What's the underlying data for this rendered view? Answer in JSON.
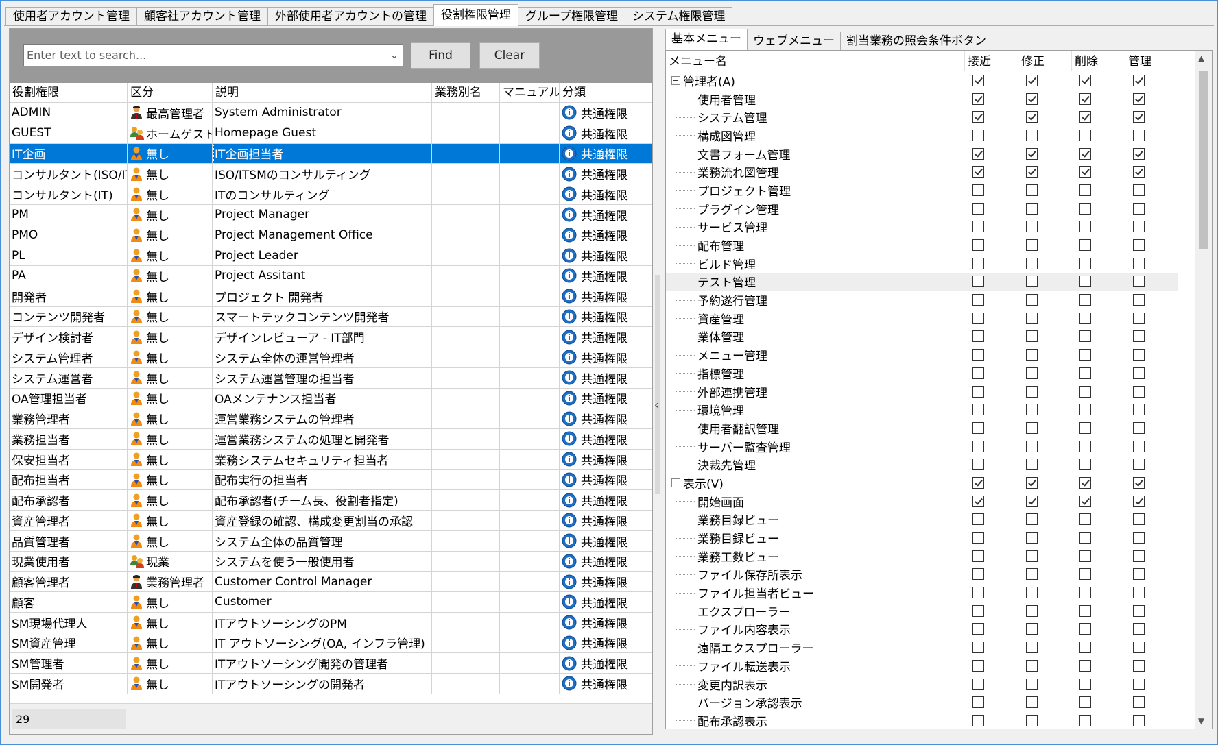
{
  "top_tabs": [
    "使用者アカウント管理",
    "顧客社アカウント管理",
    "外部使用者アカウントの管理",
    "役割権限管理",
    "グループ権限管理",
    "システム権限管理"
  ],
  "search": {
    "placeholder": "Enter text to search...",
    "find_label": "Find",
    "clear_label": "Clear"
  },
  "role_table": {
    "headers": [
      "役割権限",
      "区分",
      "説明",
      "業務別名",
      "マニュアル",
      "分類"
    ],
    "rows": [
      {
        "role": "ADMIN",
        "type": "最高管理者",
        "desc": "System Administrator",
        "cat": "共通権限",
        "icon": "admin-person-icon"
      },
      {
        "role": "GUEST",
        "type": "ホームゲスト",
        "desc": "Homepage Guest",
        "cat": "共通権限",
        "icon": "group-person-icon"
      },
      {
        "role": "IT企画",
        "type": "無し",
        "desc": "IT企画担当者",
        "cat": "共通権限",
        "icon": "person-icon",
        "selected": true
      },
      {
        "role": "コンサルタント(ISO/ITSM)",
        "type": "無し",
        "desc": "ISO/ITSMのコンサルティング",
        "cat": "共通権限",
        "icon": "person-icon"
      },
      {
        "role": "コンサルタント(IT)",
        "type": "無し",
        "desc": "ITのコンサルティング",
        "cat": "共通権限",
        "icon": "person-icon"
      },
      {
        "role": "PM",
        "type": "無し",
        "desc": "Project Manager",
        "cat": "共通権限",
        "icon": "person-icon"
      },
      {
        "role": "PMO",
        "type": "無し",
        "desc": "Project Management Office",
        "cat": "共通権限",
        "icon": "person-icon"
      },
      {
        "role": "PL",
        "type": "無し",
        "desc": "Project Leader",
        "cat": "共通権限",
        "icon": "person-icon"
      },
      {
        "role": "PA",
        "type": "無し",
        "desc": "Project Assitant",
        "cat": "共通権限",
        "icon": "person-icon"
      },
      {
        "role": "開発者",
        "type": "無し",
        "desc": "プロジェクト 開発者",
        "cat": "共通権限",
        "icon": "person-icon"
      },
      {
        "role": "コンテンツ開発者",
        "type": "無し",
        "desc": "スマートテックコンテンツ開発者",
        "cat": "共通権限",
        "icon": "person-icon"
      },
      {
        "role": "デザイン検討者",
        "type": "無し",
        "desc": "デザインレビューア - IT部門",
        "cat": "共通権限",
        "icon": "person-icon"
      },
      {
        "role": "システム管理者",
        "type": "無し",
        "desc": "システム全体の運営管理者",
        "cat": "共通権限",
        "icon": "person-icon"
      },
      {
        "role": "システム運営者",
        "type": "無し",
        "desc": "システム運営管理の担当者",
        "cat": "共通権限",
        "icon": "person-icon"
      },
      {
        "role": "OA管理担当者",
        "type": "無し",
        "desc": "OAメンテナンス担当者",
        "cat": "共通権限",
        "icon": "person-icon"
      },
      {
        "role": "業務管理者",
        "type": "無し",
        "desc": "運営業務システムの管理者",
        "cat": "共通権限",
        "icon": "person-icon"
      },
      {
        "role": "業務担当者",
        "type": "無し",
        "desc": "運営業務システムの処理と開発者",
        "cat": "共通権限",
        "icon": "person-icon"
      },
      {
        "role": "保安担当者",
        "type": "無し",
        "desc": "業務システムセキュリティ担当者",
        "cat": "共通権限",
        "icon": "person-icon"
      },
      {
        "role": "配布担当者",
        "type": "無し",
        "desc": "配布実行の担当者",
        "cat": "共通権限",
        "icon": "person-icon"
      },
      {
        "role": "配布承認者",
        "type": "無し",
        "desc": "配布承認者(チーム長、役割者指定)",
        "cat": "共通権限",
        "icon": "person-icon"
      },
      {
        "role": "資産管理者",
        "type": "無し",
        "desc": "資産登録の確認、構成変更割当の承認",
        "cat": "共通権限",
        "icon": "person-icon"
      },
      {
        "role": "品質管理者",
        "type": "無し",
        "desc": "システム全体の品質管理",
        "cat": "共通権限",
        "icon": "person-icon"
      },
      {
        "role": "現業使用者",
        "type": "現業",
        "desc": "システムを使う一般使用者",
        "cat": "共通権限",
        "icon": "group-person-icon"
      },
      {
        "role": "顧客管理者",
        "type": "業務管理者",
        "desc": "Customer Control Manager",
        "cat": "共通権限",
        "icon": "admin-person-icon"
      },
      {
        "role": "顧客",
        "type": "無し",
        "desc": "Customer",
        "cat": "共通権限",
        "icon": "person-icon"
      },
      {
        "role": "SM現場代理人",
        "type": "無し",
        "desc": "ITアウトソーシングのPM",
        "cat": "共通権限",
        "icon": "person-icon"
      },
      {
        "role": "SM資産管理",
        "type": "無し",
        "desc": "IT アウトソーシング(OA, インフラ管理)",
        "cat": "共通権限",
        "icon": "person-icon"
      },
      {
        "role": "SM管理者",
        "type": "無し",
        "desc": "ITアウトソーシング開発の管理者",
        "cat": "共通権限",
        "icon": "person-icon"
      },
      {
        "role": "SM開発者",
        "type": "無し",
        "desc": "ITアウトソーシングの開発者",
        "cat": "共通権限",
        "icon": "person-icon"
      }
    ]
  },
  "status": {
    "count": "29"
  },
  "sub_tabs": [
    "基本メニュー",
    "ウェブメニュー",
    "割当業務の照会条件ボタン"
  ],
  "menu_tree": {
    "headers": [
      "メニュー名",
      "接近",
      "修正",
      "削除",
      "管理"
    ],
    "rows": [
      {
        "name": "管理者(A)",
        "level": 0,
        "checks": [
          true,
          true,
          true,
          true
        ]
      },
      {
        "name": "使用者管理",
        "level": 1,
        "checks": [
          true,
          true,
          true,
          true
        ]
      },
      {
        "name": "システム管理",
        "level": 1,
        "checks": [
          true,
          true,
          true,
          true
        ]
      },
      {
        "name": "構成図管理",
        "level": 1,
        "checks": [
          false,
          false,
          false,
          false
        ]
      },
      {
        "name": "文書フォーム管理",
        "level": 1,
        "checks": [
          true,
          true,
          true,
          true
        ]
      },
      {
        "name": "業務流れ図管理",
        "level": 1,
        "checks": [
          true,
          true,
          true,
          true
        ]
      },
      {
        "name": "プロジェクト管理",
        "level": 1,
        "checks": [
          false,
          false,
          false,
          false
        ]
      },
      {
        "name": "プラグイン管理",
        "level": 1,
        "checks": [
          false,
          false,
          false,
          false
        ]
      },
      {
        "name": "サービス管理",
        "level": 1,
        "checks": [
          false,
          false,
          false,
          false
        ]
      },
      {
        "name": "配布管理",
        "level": 1,
        "checks": [
          false,
          false,
          false,
          false
        ]
      },
      {
        "name": "ビルド管理",
        "level": 1,
        "checks": [
          false,
          false,
          false,
          false
        ]
      },
      {
        "name": "テスト管理",
        "level": 1,
        "checks": [
          false,
          false,
          false,
          false
        ],
        "hover": true
      },
      {
        "name": "予約遂行管理",
        "level": 1,
        "checks": [
          false,
          false,
          false,
          false
        ]
      },
      {
        "name": "資産管理",
        "level": 1,
        "checks": [
          false,
          false,
          false,
          false
        ]
      },
      {
        "name": "業体管理",
        "level": 1,
        "checks": [
          false,
          false,
          false,
          false
        ]
      },
      {
        "name": "メニュー管理",
        "level": 1,
        "checks": [
          false,
          false,
          false,
          false
        ]
      },
      {
        "name": "指標管理",
        "level": 1,
        "checks": [
          false,
          false,
          false,
          false
        ]
      },
      {
        "name": "外部連携管理",
        "level": 1,
        "checks": [
          false,
          false,
          false,
          false
        ]
      },
      {
        "name": "環境管理",
        "level": 1,
        "checks": [
          false,
          false,
          false,
          false
        ]
      },
      {
        "name": "使用者翻訳管理",
        "level": 1,
        "checks": [
          false,
          false,
          false,
          false
        ]
      },
      {
        "name": "サーバー監査管理",
        "level": 1,
        "checks": [
          false,
          false,
          false,
          false
        ]
      },
      {
        "name": "決裁先管理",
        "level": 1,
        "checks": [
          false,
          false,
          false,
          false
        ]
      },
      {
        "name": "表示(V)",
        "level": 0,
        "checks": [
          true,
          true,
          true,
          true
        ]
      },
      {
        "name": "開始画面",
        "level": 1,
        "checks": [
          true,
          true,
          true,
          true
        ]
      },
      {
        "name": "業務目録ビュー",
        "level": 1,
        "checks": [
          false,
          false,
          false,
          false
        ]
      },
      {
        "name": "業務目録ビュー",
        "level": 1,
        "checks": [
          false,
          false,
          false,
          false
        ]
      },
      {
        "name": "業務工数ビュー",
        "level": 1,
        "checks": [
          false,
          false,
          false,
          false
        ]
      },
      {
        "name": "ファイル保存所表示",
        "level": 1,
        "checks": [
          false,
          false,
          false,
          false
        ]
      },
      {
        "name": "ファイル担当者ビュー",
        "level": 1,
        "checks": [
          false,
          false,
          false,
          false
        ]
      },
      {
        "name": "エクスプローラー",
        "level": 1,
        "checks": [
          false,
          false,
          false,
          false
        ]
      },
      {
        "name": "ファイル内容表示",
        "level": 1,
        "checks": [
          false,
          false,
          false,
          false
        ]
      },
      {
        "name": "遠隔エクスプローラー",
        "level": 1,
        "checks": [
          false,
          false,
          false,
          false
        ]
      },
      {
        "name": "ファイル転送表示",
        "level": 1,
        "checks": [
          false,
          false,
          false,
          false
        ]
      },
      {
        "name": "変更内訳表示",
        "level": 1,
        "checks": [
          false,
          false,
          false,
          false
        ]
      },
      {
        "name": "バージョン承認表示",
        "level": 1,
        "checks": [
          false,
          false,
          false,
          false
        ]
      },
      {
        "name": "配布承認表示",
        "level": 1,
        "checks": [
          false,
          false,
          false,
          false
        ]
      }
    ]
  },
  "colors": {
    "selection": "#0078d7",
    "window_border": "#4a90d9",
    "info_icon": "#1f6fc5",
    "person_icon": "#f0a020"
  }
}
